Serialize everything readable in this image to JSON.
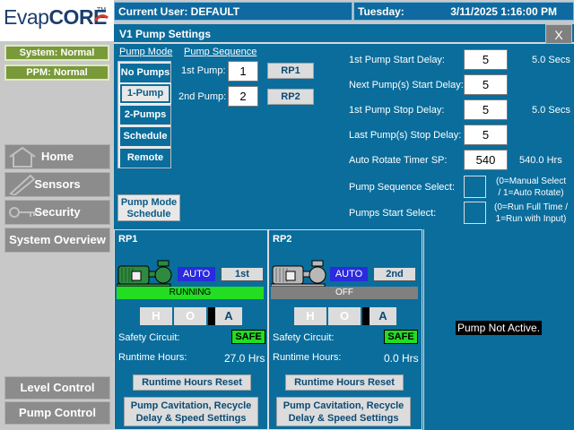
{
  "brand": {
    "name_part1": "Evap",
    "name_part2": "CORE",
    "tm": "TM"
  },
  "header": {
    "current_user": "Current User: DEFAULT",
    "day": "Tuesday:",
    "datetime": "3/11/2025 1:16:00 PM"
  },
  "sidebar": {
    "system_status": "System: Normal",
    "ppm_status": "PPM: Normal",
    "nav": {
      "home": "Home",
      "sensors": "Sensors",
      "security": "Security",
      "system_overview": "System Overview",
      "level_control": "Level Control",
      "pump_control": "Pump Control"
    }
  },
  "window": {
    "title": "V1 Pump Settings",
    "close": "X"
  },
  "pump_mode": {
    "heading": "Pump Mode",
    "options": [
      "No Pumps",
      "1-Pump",
      "2-Pumps",
      "Schedule",
      "Remote"
    ],
    "selected": "1-Pump",
    "schedule_button": "Pump Mode Schedule"
  },
  "pump_sequence": {
    "heading": "Pump Sequence",
    "first_label": "1st Pump:",
    "first_value": "1",
    "first_pump": "RP1",
    "second_label": "2nd Pump:",
    "second_value": "2",
    "second_pump": "RP2"
  },
  "delays": {
    "first_start_label": "1st Pump Start Delay:",
    "first_start_value": "5",
    "first_start_actual": "5.0",
    "first_start_unit": "Secs",
    "next_start_label": "Next Pump(s) Start Delay:",
    "next_start_value": "5",
    "first_stop_label": "1st Pump Stop Delay:",
    "first_stop_value": "5",
    "first_stop_actual": "5.0",
    "first_stop_unit": "Secs",
    "last_stop_label": "Last Pump(s) Stop Delay:",
    "last_stop_value": "5",
    "rotate_label": "Auto Rotate Timer SP:",
    "rotate_value": "540",
    "rotate_actual": "540.0",
    "rotate_unit": "Hrs",
    "seq_select_label": "Pump Sequence Select:",
    "seq_select_note1": "(0=Manual Select",
    "seq_select_note2": "/ 1=Auto Rotate)",
    "start_select_label": "Pumps Start Select:",
    "start_select_note1": "(0=Run Full Time /",
    "start_select_note2": "1=Run with Input)"
  },
  "pumps": [
    {
      "name": "RP1",
      "mode": "AUTO",
      "order": "1st",
      "state": "RUNNING",
      "state_color": "#22dd22",
      "hoa": {
        "h": "H",
        "o": "O",
        "a": "A"
      },
      "safety_label": "Safety Circuit:",
      "safety": "SAFE",
      "runtime_label": "Runtime Hours:",
      "runtime": "27.0 Hrs",
      "reset": "Runtime Hours Reset",
      "cav1": "Pump Cavitation, Recycle",
      "cav2": "Delay & Speed Settings",
      "motor_color": "#2e8a3e"
    },
    {
      "name": "RP2",
      "mode": "AUTO",
      "order": "2nd",
      "state": "OFF",
      "state_color": "#808080",
      "hoa": {
        "h": "H",
        "o": "O",
        "a": "A"
      },
      "safety_label": "Safety Circuit:",
      "safety": "SAFE",
      "runtime_label": "Runtime Hours:",
      "runtime": "0.0 Hrs",
      "reset": "Runtime Hours Reset",
      "cav1": "Pump Cavitation, Recycle",
      "cav2": "Delay & Speed Settings",
      "motor_color": "#9a9a9a"
    }
  ],
  "inactive": {
    "label": "Pump Not Active."
  }
}
